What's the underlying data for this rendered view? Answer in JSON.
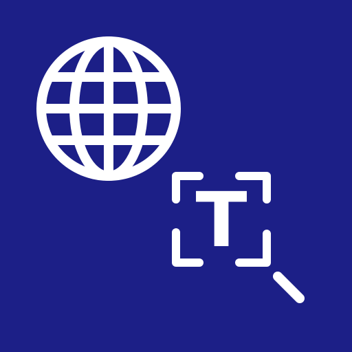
{
  "app_icon": {
    "background_color": "#1c1f87",
    "foreground_color": "#ffffff",
    "icons": {
      "globe": "globe-icon",
      "text_scan": "text-scan-icon",
      "magnifier": "magnifier-icon"
    },
    "scan_letter": "T"
  }
}
